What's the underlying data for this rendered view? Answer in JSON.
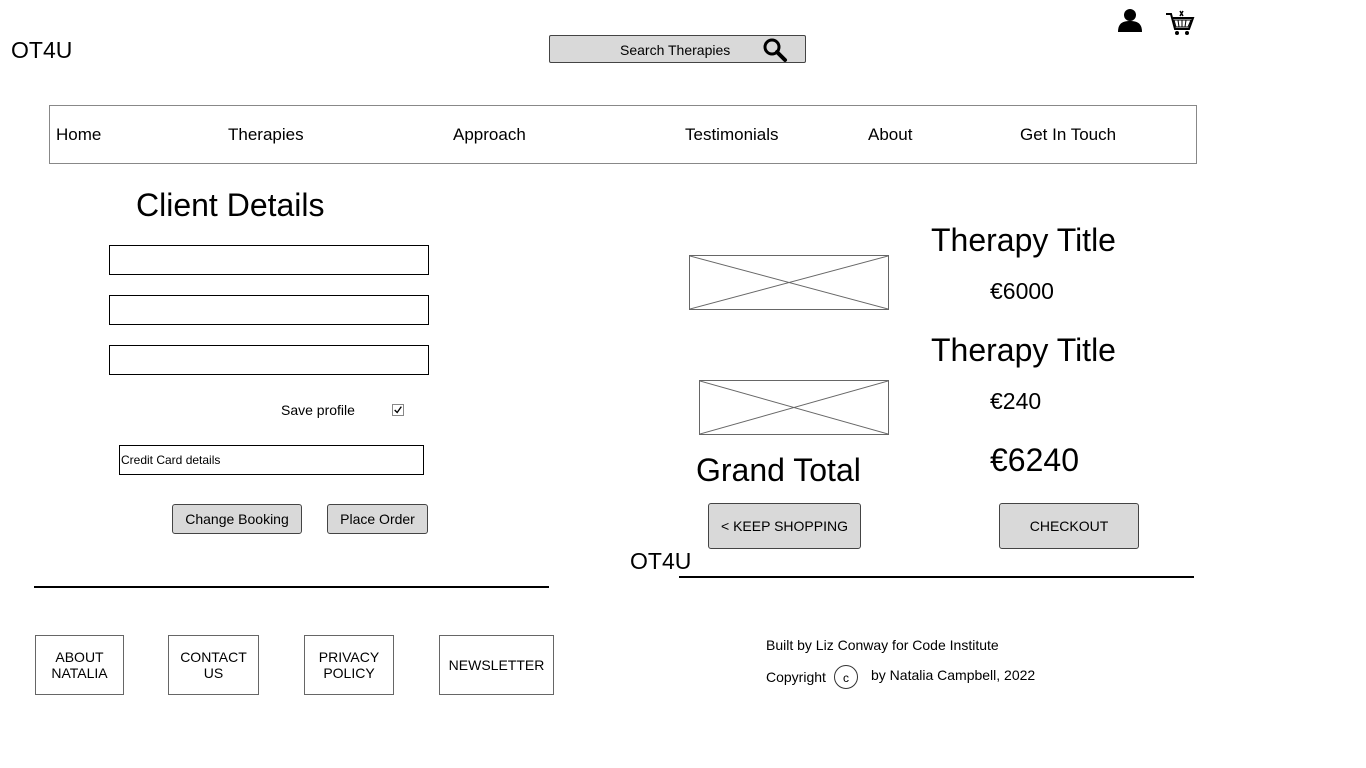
{
  "header": {
    "logo": "OT4U",
    "search_label": "Search Therapies",
    "icons": {
      "search": "search-icon",
      "account": "user-icon",
      "cart": "cart-icon"
    }
  },
  "nav": {
    "items": [
      {
        "label": "Home"
      },
      {
        "label": "Therapies"
      },
      {
        "label": "Approach"
      },
      {
        "label": "Testimonials"
      },
      {
        "label": "About"
      },
      {
        "label": "Get In Touch"
      }
    ]
  },
  "client": {
    "title": "Client Details",
    "fields": [
      {
        "value": ""
      },
      {
        "value": ""
      },
      {
        "value": ""
      }
    ],
    "save_profile_label": "Save profile",
    "save_profile_checked": true,
    "credit_card_label": "Credit Card details",
    "change_booking_label": "Change Booking",
    "place_order_label": "Place Order"
  },
  "footer_links": [
    {
      "line1": "ABOUT",
      "line2": "NATALIA"
    },
    {
      "line1": "CONTACT",
      "line2": "US"
    },
    {
      "line1": "PRIVACY",
      "line2": "POLICY"
    },
    {
      "line1": "NEWSLETTER",
      "line2": ""
    }
  ],
  "cart": {
    "items": [
      {
        "title": "Therapy Title",
        "price": "€6000"
      },
      {
        "title": "Therapy Title",
        "price": "€240"
      }
    ],
    "grand_total_label": "Grand Total",
    "grand_total_value": "€6240",
    "keep_shopping_label": "< KEEP SHOPPING",
    "checkout_label": "CHECKOUT"
  },
  "footer": {
    "logo": "OT4U",
    "built_by": "Built by Liz Conway for Code Institute",
    "copyright_label": "Copyright",
    "copyright_symbol": "c",
    "byline": "by Natalia Campbell, 2022"
  },
  "colors": {
    "button_bg": "#d9d9d9",
    "border": "#444444",
    "text": "#000000"
  }
}
